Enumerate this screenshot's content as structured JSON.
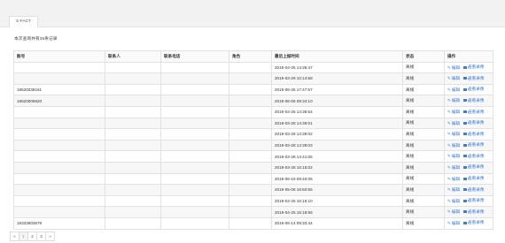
{
  "tabs": [
    {
      "label": "S-FACT"
    }
  ],
  "summary": "本次查询共有35条记录",
  "table": {
    "headers": [
      "账号",
      "联系人",
      "联系电话",
      "角色",
      "最后上报时间",
      "状态",
      "操作"
    ],
    "rows": [
      {
        "account": "",
        "contact": "",
        "phone": "",
        "role": "",
        "last_report": "2019-04-25 14:36:47",
        "status": "离线"
      },
      {
        "account": "",
        "contact": "",
        "phone": "",
        "role": "",
        "last_report": "2019-03-29 10:14:58",
        "status": "离线"
      },
      {
        "account": "18520338161",
        "contact": "",
        "phone": "",
        "role": "",
        "last_report": "2019-06-25 17:47:57",
        "status": "离线"
      },
      {
        "account": "18620006620",
        "contact": "",
        "phone": "",
        "role": "",
        "last_report": "2019-06-06 09:34:10",
        "status": "离线"
      },
      {
        "account": "",
        "contact": "",
        "phone": "",
        "role": "",
        "last_report": "2019-04-25 14:38:54",
        "status": "离线"
      },
      {
        "account": "",
        "contact": "",
        "phone": "",
        "role": "",
        "last_report": "2019-03-28 14:39:01",
        "status": "离线"
      },
      {
        "account": "",
        "contact": "",
        "phone": "",
        "role": "",
        "last_report": "2019-03-28 14:39:02",
        "status": "离线"
      },
      {
        "account": "",
        "contact": "",
        "phone": "",
        "role": "",
        "last_report": "2019-03-28 14:39:03",
        "status": "离线"
      },
      {
        "account": "",
        "contact": "",
        "phone": "",
        "role": "",
        "last_report": "2019-03-28 14:41:05",
        "status": "离线"
      },
      {
        "account": "",
        "contact": "",
        "phone": "",
        "role": "",
        "last_report": "2019-03-28 16:15:02",
        "status": "离线"
      },
      {
        "account": "",
        "contact": "",
        "phone": "",
        "role": "",
        "last_report": "2019-06-19 09:40:06",
        "status": "离线"
      },
      {
        "account": "",
        "contact": "",
        "phone": "",
        "role": "",
        "last_report": "2019-05-06 16:50:55",
        "status": "离线"
      },
      {
        "account": "",
        "contact": "",
        "phone": "",
        "role": "",
        "last_report": "2019-04-25 16:16:10",
        "status": "离线"
      },
      {
        "account": "",
        "contact": "",
        "phone": "",
        "role": "",
        "last_report": "2019-04-25 16:18:56",
        "status": "离线"
      },
      {
        "account": "18333603679",
        "contact": "",
        "phone": "",
        "role": "",
        "last_report": "2019-06-14 09:33:44",
        "status": "离线"
      }
    ],
    "actions": {
      "edit": "编辑",
      "video": "查看录像"
    }
  },
  "pagination": {
    "prev": "«",
    "pages": [
      "1",
      "2",
      "3"
    ],
    "next": "»",
    "current": "1"
  }
}
